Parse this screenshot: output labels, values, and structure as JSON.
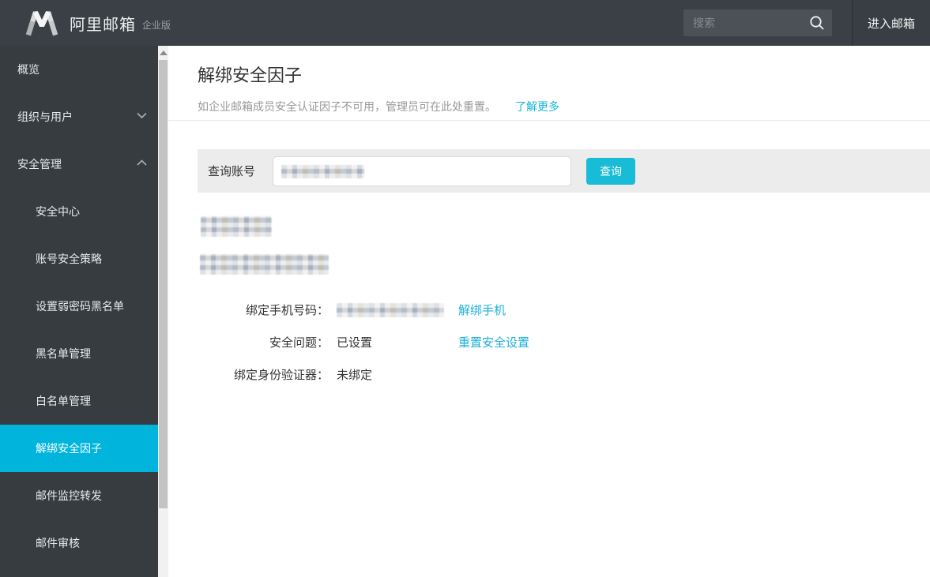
{
  "topbar": {
    "brand": "阿里邮箱",
    "brand_suffix": "企业版",
    "search_placeholder": "搜索",
    "enter_mailbox": "进入邮箱"
  },
  "sidebar": {
    "items": [
      {
        "label": "概览"
      },
      {
        "label": "组织与用户",
        "chevron": "down"
      },
      {
        "label": "安全管理",
        "chevron": "up"
      }
    ],
    "security_subitems": [
      "安全中心",
      "账号安全策略",
      "设置弱密码黑名单",
      "黑名单管理",
      "白名单管理",
      "解绑安全因子",
      "邮件监控转发",
      "邮件审核"
    ],
    "active_item": "解绑安全因子"
  },
  "main": {
    "title": "解绑安全因子",
    "description": "如企业邮箱成员安全认证因子不可用，管理员可在此处重置。",
    "learn_more": "了解更多",
    "query": {
      "label": "查询账号",
      "button": "查询"
    },
    "details": [
      {
        "label": "绑定手机号码：",
        "value": "",
        "link": "解绑手机"
      },
      {
        "label": "安全问题：",
        "value": "已设置",
        "link": "重置安全设置"
      },
      {
        "label": "绑定身份验证器：",
        "value": "未绑定",
        "link": ""
      }
    ]
  },
  "colors": {
    "accent": "#00b4dc",
    "button": "#18bcd6",
    "link": "#1db1d8",
    "topbar_bg": "#3a4045",
    "sidebar_bg": "#363c40"
  }
}
